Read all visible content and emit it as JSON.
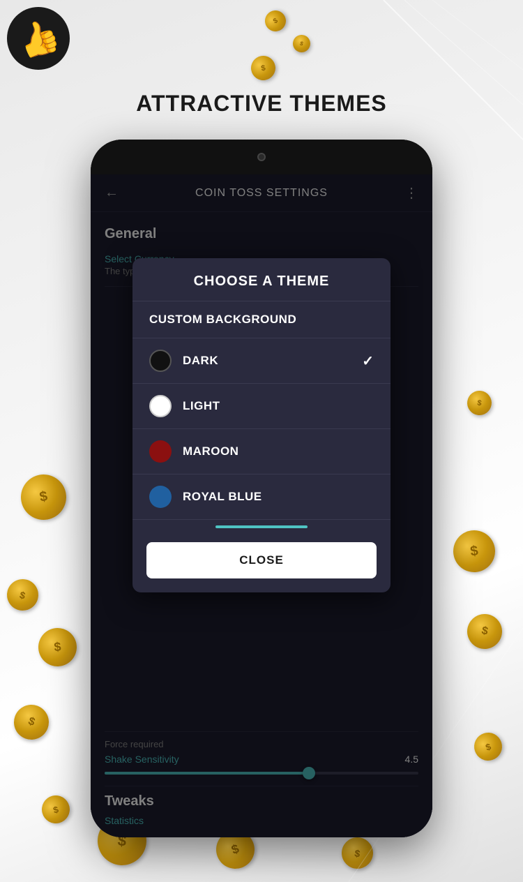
{
  "page": {
    "title": "ATTRACTIVE THEMES",
    "background_color": "#e8e8e8"
  },
  "app_icon": {
    "emoji": "👍",
    "aria": "coin toss app icon"
  },
  "phone": {
    "header": {
      "title": "COIN TOSS SETTINGS",
      "back_label": "←",
      "more_label": "⋮"
    },
    "settings": {
      "general_label": "General",
      "select_currency_label": "Select Currency",
      "select_currency_desc": "The type of coin to be displayed"
    },
    "dialog": {
      "title": "CHOOSE A THEME",
      "custom_background_label": "CUSTOM BACKGROUND",
      "options": [
        {
          "id": "dark",
          "label": "DARK",
          "color": "dark",
          "selected": true
        },
        {
          "id": "light",
          "label": "LIGHT",
          "color": "light",
          "selected": false
        },
        {
          "id": "maroon",
          "label": "MAROON",
          "color": "maroon",
          "selected": false
        },
        {
          "id": "royal-blue",
          "label": "ROYAL BLUE",
          "color": "royal-blue",
          "selected": false
        }
      ],
      "close_label": "CLOSE"
    },
    "bottom": {
      "force_required_label": "Force required",
      "shake_sensitivity_label": "Shake Sensitivity",
      "shake_value": "4.5",
      "tweaks_label": "Tweaks",
      "statistics_label": "Statistics"
    }
  }
}
